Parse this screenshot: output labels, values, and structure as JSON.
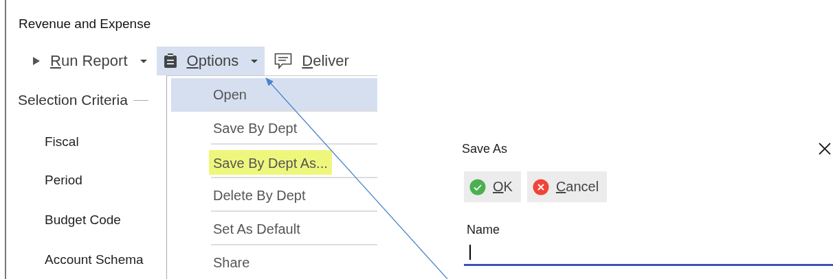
{
  "panel": {
    "title": "Revenue and Expense",
    "toolbar": [
      {
        "label": "Run Report",
        "kind": "run",
        "active": false,
        "dropdown": true
      },
      {
        "label": "Options",
        "kind": "options",
        "active": true,
        "dropdown": true
      },
      {
        "label": "Deliver",
        "kind": "delivery",
        "active": false,
        "dropdown": false
      }
    ],
    "section": "Selection Criteria",
    "fields": [
      "Fiscal",
      "Period",
      "Budget Code",
      "Account Schema"
    ],
    "menu": [
      {
        "label": "Open",
        "selected": true,
        "marked": false
      },
      {
        "label": "Save By Dept",
        "selected": false,
        "marked": false
      },
      {
        "label": "Save By Dept As...",
        "selected": false,
        "marked": true
      },
      {
        "label": "Delete By Dept",
        "selected": false,
        "marked": false
      },
      {
        "label": "Set As Default",
        "selected": false,
        "marked": false
      },
      {
        "label": "Share",
        "selected": false,
        "marked": false
      }
    ]
  },
  "dialog": {
    "title": "Save As",
    "buttons": [
      {
        "label": "OK",
        "kind": "ok"
      },
      {
        "label": "Cancel",
        "kind": "cancel"
      }
    ],
    "field": {
      "label": "Name",
      "focused": true
    }
  }
}
